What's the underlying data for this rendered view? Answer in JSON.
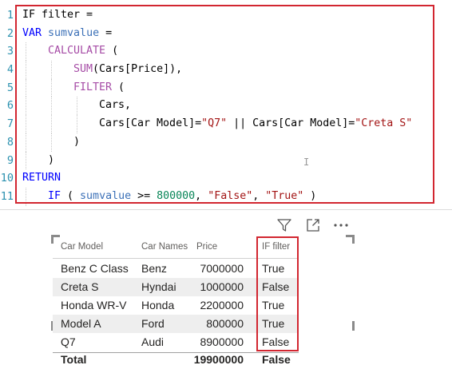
{
  "editor": {
    "line_numbers": [
      "1",
      "2",
      "3",
      "4",
      "5",
      "6",
      "7",
      "8",
      "9",
      "10",
      "11"
    ],
    "lines": [
      [
        {
          "t": "IF filter =",
          "c": "pl"
        }
      ],
      [
        {
          "t": "VAR ",
          "c": "kw"
        },
        {
          "t": "sumvalue",
          "c": "id"
        },
        {
          "t": " =",
          "c": "pl"
        }
      ],
      [
        {
          "t": "CALCULATE",
          "c": "fn"
        },
        {
          "t": " (",
          "c": "pl"
        }
      ],
      [
        {
          "t": "SUM",
          "c": "fn"
        },
        {
          "t": "(Cars[Price]),",
          "c": "pl"
        }
      ],
      [
        {
          "t": "FILTER",
          "c": "fn"
        },
        {
          "t": " (",
          "c": "pl"
        }
      ],
      [
        {
          "t": "Cars,",
          "c": "pl"
        }
      ],
      [
        {
          "t": "Cars[Car Model]=",
          "c": "pl"
        },
        {
          "t": "\"Q7\"",
          "c": "st"
        },
        {
          "t": " || Cars[Car Model]=",
          "c": "pl"
        },
        {
          "t": "\"Creta S\"",
          "c": "st"
        }
      ],
      [
        {
          "t": ")",
          "c": "pl"
        }
      ],
      [
        {
          "t": ")",
          "c": "pl"
        }
      ],
      [
        {
          "t": "RETURN",
          "c": "kw"
        }
      ],
      [
        {
          "t": "IF",
          "c": "kw"
        },
        {
          "t": " ( ",
          "c": "pl"
        },
        {
          "t": "sumvalue",
          "c": "id"
        },
        {
          "t": " >= ",
          "c": "pl"
        },
        {
          "t": "800000",
          "c": "nm"
        },
        {
          "t": ", ",
          "c": "pl"
        },
        {
          "t": "\"False\"",
          "c": "st"
        },
        {
          "t": ", ",
          "c": "pl"
        },
        {
          "t": "\"True\"",
          "c": "st"
        },
        {
          "t": " )",
          "c": "pl"
        }
      ]
    ],
    "text_cursor_glyph": "I"
  },
  "toolbar": {
    "icons": [
      "filter-icon",
      "focus-mode-icon",
      "more-options-icon"
    ]
  },
  "table": {
    "columns": [
      "Car Model",
      "Car Names",
      "Price",
      "IF filter"
    ],
    "rows": [
      [
        "Benz C Class",
        "Benz",
        "7000000",
        "True"
      ],
      [
        "Creta S",
        "Hyndai",
        "1000000",
        "False"
      ],
      [
        "Honda WR-V",
        "Honda",
        "2200000",
        "True"
      ],
      [
        "Model A",
        "Ford",
        "800000",
        "True"
      ],
      [
        "Q7",
        "Audi",
        "8900000",
        "False"
      ]
    ],
    "total": [
      "Total",
      "",
      "19900000",
      "False"
    ]
  },
  "colors": {
    "highlight_box": "#d22630",
    "keyword": "#0000ff",
    "function": "#a64ca6",
    "string": "#a31515",
    "number": "#098658",
    "variable": "#3b70b7",
    "line_number": "#2b91af"
  }
}
